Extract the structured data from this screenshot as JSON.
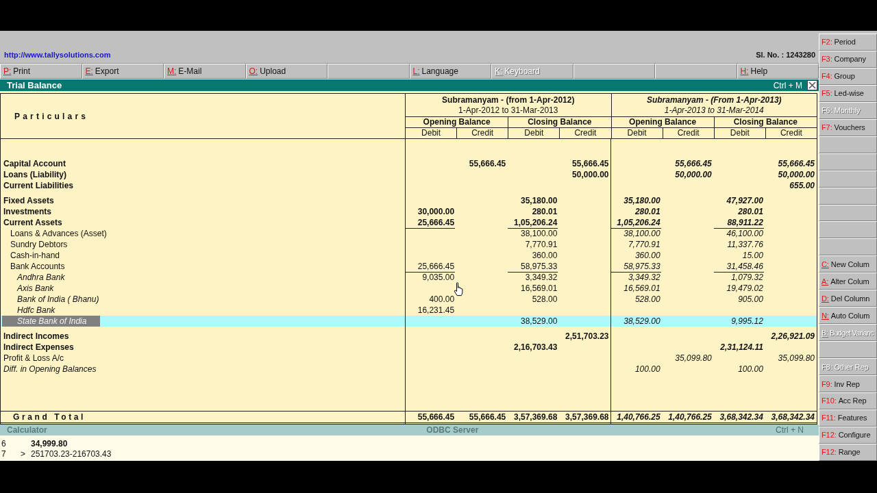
{
  "header": {
    "website": "http://www.tallysolutions.com",
    "serial_number": "Sl. No. : 1243280"
  },
  "button_bar": [
    {
      "kind": "letter",
      "key": "P:",
      "label": "Print",
      "disabled": false
    },
    {
      "kind": "letter",
      "key": "E:",
      "label": "Export",
      "disabled": false
    },
    {
      "kind": "letter",
      "key": "M:",
      "label": "E-Mail",
      "disabled": false
    },
    {
      "kind": "letter",
      "key": "O:",
      "label": "Upload",
      "disabled": false
    },
    {
      "kind": "blank"
    },
    {
      "kind": "letter",
      "key": "L:",
      "label": "Language",
      "disabled": false
    },
    {
      "kind": "letter",
      "key": "K:",
      "label": "Keyboard",
      "disabled": true
    },
    {
      "kind": "blank"
    },
    {
      "kind": "blank"
    },
    {
      "kind": "letter",
      "key": "H:",
      "label": "Help",
      "disabled": false
    }
  ],
  "report": {
    "title": "Trial Balance",
    "shortcut": "Ctrl + M",
    "particulars_heading": "Particulars",
    "column_groups": [
      {
        "kind": "primary",
        "company": "Subramanyam - (from 1-Apr-2012)",
        "period": "1-Apr-2012 to 31-Mar-2013",
        "balances": [
          {
            "label": "Opening Balance",
            "columns": [
              "Debit",
              "Credit"
            ]
          },
          {
            "label": "Closing Balance",
            "columns": [
              "Debit",
              "Credit"
            ]
          }
        ]
      },
      {
        "kind": "comparison",
        "company": "Subramanyam - (From 1-Apr-2013)",
        "period": "1-Apr-2013 to 31-Mar-2014",
        "balances": [
          {
            "label": "Opening Balance",
            "columns": [
              "Debit",
              "Credit"
            ]
          },
          {
            "label": "Closing Balance",
            "columns": [
              "Debit",
              "Credit"
            ]
          }
        ]
      }
    ],
    "sections": [
      [
        {
          "name": "Capital Account",
          "kind": "group",
          "selected": false,
          "primary_opening_credit": "55,666.45",
          "primary_closing_credit": "55,666.45",
          "comparison_opening_credit": "55,666.45",
          "comparison_closing_credit": "55,666.45"
        },
        {
          "name": "Loans (Liability)",
          "kind": "group",
          "selected": false,
          "primary_closing_credit": "50,000.00",
          "comparison_opening_credit": "50,000.00",
          "comparison_closing_credit": "50,000.00"
        },
        {
          "name": "Current Liabilities",
          "kind": "group",
          "selected": false,
          "comparison_closing_credit": "655.00"
        }
      ],
      [
        {
          "name": "Fixed Assets",
          "kind": "group",
          "selected": false,
          "primary_closing_debit": "35,180.00",
          "comparison_opening_debit": "35,180.00",
          "comparison_closing_debit": "47,927.00"
        },
        {
          "name": "Investments",
          "kind": "group",
          "selected": false,
          "primary_opening_debit": "30,000.00",
          "primary_closing_debit": "280.01",
          "comparison_opening_debit": "280.01",
          "comparison_closing_debit": "280.01"
        },
        {
          "name": "Current Assets",
          "kind": "group",
          "selected": false,
          "primary_opening_debit": "25,666.45",
          "primary_closing_debit": "1,05,206.24",
          "comparison_opening_debit": "1,05,206.24",
          "comparison_closing_debit": "88,911.22",
          "children": [
            {
              "name": "Loans & Advances (Asset)",
              "kind": "group",
              "selected": false,
              "primary_closing_debit": "38,100.00",
              "comparison_opening_debit": "38,100.00",
              "comparison_closing_debit": "46,100.00"
            },
            {
              "name": "Sundry Debtors",
              "kind": "group",
              "selected": false,
              "primary_closing_debit": "7,770.91",
              "comparison_opening_debit": "7,770.91",
              "comparison_closing_debit": "11,337.76"
            },
            {
              "name": "Cash-in-hand",
              "kind": "group",
              "selected": false,
              "primary_closing_debit": "360.00",
              "comparison_opening_debit": "360.00",
              "comparison_closing_debit": "15.00"
            },
            {
              "name": "Bank Accounts",
              "kind": "group",
              "selected": false,
              "primary_opening_debit": "25,666.45",
              "primary_closing_debit": "58,975.33",
              "comparison_opening_debit": "58,975.33",
              "comparison_closing_debit": "31,458.46",
              "children": [
                {
                  "name": "Andhra Bank",
                  "kind": "ledger",
                  "selected": false,
                  "primary_opening_debit": "9,035.00",
                  "primary_closing_debit": "3,349.32",
                  "comparison_opening_debit": "3,349.32",
                  "comparison_closing_debit": "1,079.32"
                },
                {
                  "name": "Axis Bank",
                  "kind": "ledger",
                  "selected": false,
                  "primary_closing_debit": "16,569.01",
                  "comparison_opening_debit": "16,569.01",
                  "comparison_closing_debit": "19,479.02"
                },
                {
                  "name": "Bank of India ( Bhanu)",
                  "kind": "ledger",
                  "selected": false,
                  "primary_opening_debit": "400.00",
                  "primary_closing_debit": "528.00",
                  "comparison_opening_debit": "528.00",
                  "comparison_closing_debit": "905.00"
                },
                {
                  "name": "Hdfc Bank",
                  "kind": "ledger",
                  "selected": false,
                  "primary_opening_debit": "16,231.45"
                },
                {
                  "name": "State Bank of India",
                  "kind": "ledger",
                  "selected": true,
                  "primary_closing_debit": "38,529.00",
                  "comparison_opening_debit": "38,529.00",
                  "comparison_closing_debit": "9,995.12"
                }
              ]
            }
          ]
        }
      ],
      [
        {
          "name": "Indirect Incomes",
          "kind": "group",
          "selected": false,
          "primary_closing_credit": "2,51,703.23",
          "comparison_closing_credit": "2,26,921.09"
        },
        {
          "name": "Indirect Expenses",
          "kind": "group",
          "selected": false,
          "primary_closing_debit": "2,16,703.43",
          "comparison_closing_debit": "2,31,124.11"
        },
        {
          "name": "Profit & Loss A/c",
          "kind": "primary",
          "selected": false,
          "comparison_opening_credit": "35,099.80",
          "comparison_closing_credit": "35,099.80"
        },
        {
          "name": "Diff. in Opening Balances",
          "kind": "ledger",
          "selected": false,
          "comparison_opening_debit": "100.00",
          "comparison_closing_debit": "100.00"
        }
      ]
    ],
    "grand_total": {
      "label": "Grand Total",
      "values": [
        "55,666.45",
        "55,666.45",
        "3,57,369.68",
        "3,57,369.68",
        "1,40,766.25",
        "1,40,766.25",
        "3,68,342.34",
        "3,68,342.34"
      ]
    }
  },
  "calculator": {
    "title": "Calculator",
    "server": "ODBC Server",
    "shortcut": "Ctrl + N",
    "lines": [
      {
        "number": "6",
        "kind": "result",
        "text": "34,999.80"
      },
      {
        "number": "7",
        "kind": "input",
        "prompt": ">",
        "text": "251703.23-216703.43"
      }
    ]
  },
  "side_panel": [
    {
      "kind": "function",
      "key": "F2:",
      "label": "Period",
      "disabled": false
    },
    {
      "kind": "function",
      "key": "F3:",
      "label": "Company",
      "disabled": false
    },
    {
      "kind": "function",
      "key": "F4:",
      "label": "Group",
      "disabled": false
    },
    {
      "kind": "function",
      "key": "F5:",
      "label": "Led-wise",
      "disabled": false
    },
    {
      "kind": "function",
      "key": "F6:",
      "label": "Monthly",
      "disabled": true
    },
    {
      "kind": "function",
      "key": "F7:",
      "label": "Vouchers",
      "disabled": false
    },
    {
      "kind": "blank"
    },
    {
      "kind": "blank"
    },
    {
      "kind": "blank"
    },
    {
      "kind": "blank"
    },
    {
      "kind": "blank"
    },
    {
      "kind": "blank"
    },
    {
      "kind": "blank"
    },
    {
      "kind": "letter",
      "key": "C:",
      "label": "New Colum",
      "disabled": false
    },
    {
      "kind": "letter",
      "key": "A:",
      "label": "Alter Colum",
      "disabled": false
    },
    {
      "kind": "letter",
      "key": "D:",
      "label": "Del Column",
      "disabled": false
    },
    {
      "kind": "letter",
      "key": "N:",
      "label": "Auto Colum",
      "disabled": false
    },
    {
      "kind": "letter",
      "key": "B:",
      "label": "Budget Varianc",
      "disabled": true
    },
    {
      "kind": "blank"
    },
    {
      "kind": "function",
      "key": "F8:",
      "label": "Other Rep",
      "disabled": true
    },
    {
      "kind": "function",
      "key": "F9:",
      "label": "Inv Rep",
      "disabled": false
    },
    {
      "kind": "function",
      "key": "F10:",
      "label": "Acc Rep",
      "disabled": false
    },
    {
      "kind": "function",
      "key": "F11:",
      "label": "Features",
      "disabled": false
    },
    {
      "kind": "function",
      "key": "F12:",
      "label": "Configure",
      "disabled": false
    },
    {
      "kind": "function",
      "key": "F12:",
      "label": "Range",
      "disabled": false
    }
  ]
}
